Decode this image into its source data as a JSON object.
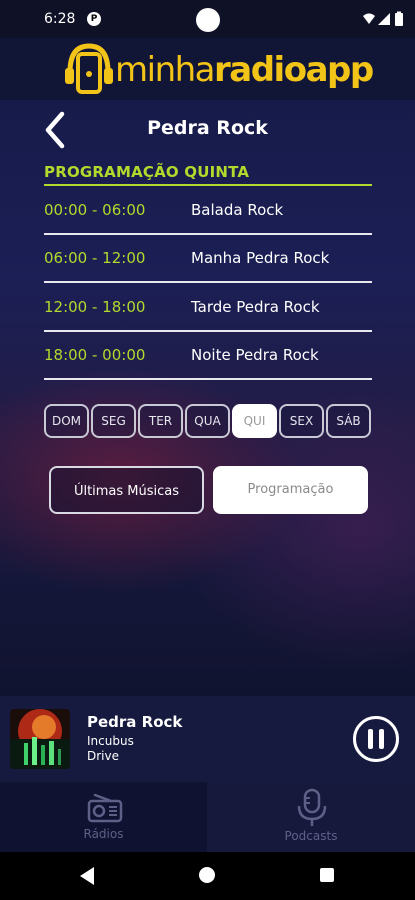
{
  "status_bar": {
    "time": "6:28",
    "notification_glyph": "P",
    "icons": [
      "wifi-icon",
      "signal-icon",
      "battery-icon"
    ]
  },
  "header": {
    "logo": {
      "part1": "minha",
      "part2": "radio",
      "part3": "app",
      "color": "#f3c418"
    },
    "title": "Pedra Rock",
    "back_icon": "chevron-left-icon"
  },
  "schedule": {
    "heading": "PROGRAMAÇÃO QUINTA",
    "accent": "#b2d92b",
    "rows": [
      {
        "time": "00:00 - 06:00",
        "name": "Balada Rock"
      },
      {
        "time": "06:00 - 12:00",
        "name": "Manha Pedra Rock"
      },
      {
        "time": "12:00 - 18:00",
        "name": "Tarde Pedra Rock"
      },
      {
        "time": "18:00 - 00:00",
        "name": "Noite Pedra Rock"
      }
    ]
  },
  "days": [
    "DOM",
    "SEG",
    "TER",
    "QUA",
    "QUI",
    "SEX",
    "SÁB"
  ],
  "selected_day": "QUI",
  "buttons": {
    "latest": "Últimas Músicas",
    "schedule": "Programação"
  },
  "player": {
    "station": "Pedra Rock",
    "artist": "Incubus",
    "song": "Drive",
    "state_icon": "pause-icon"
  },
  "tabs": [
    {
      "label": "Rádios",
      "icon": "radio-icon"
    },
    {
      "label": "Podcasts",
      "icon": "microphone-icon"
    }
  ],
  "system_nav": [
    "back-triangle-icon",
    "home-circle-icon",
    "recents-square-icon"
  ]
}
